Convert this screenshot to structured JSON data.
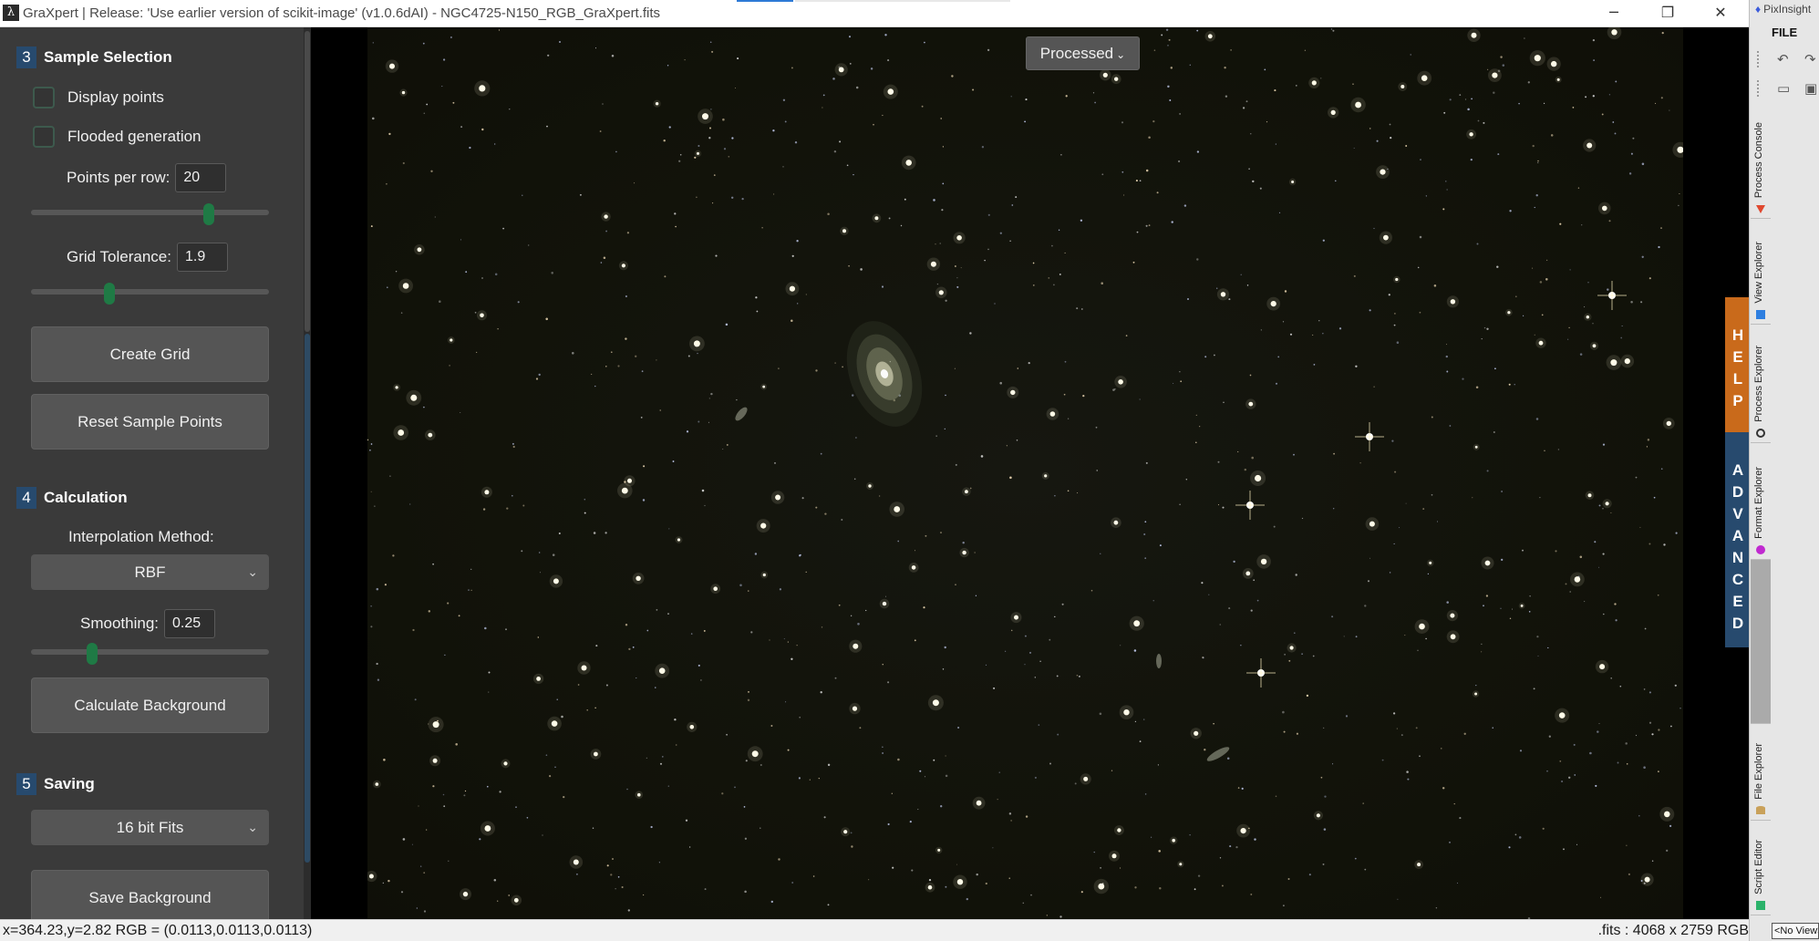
{
  "window": {
    "title": "GraXpert | Release: 'Use earlier version of scikit-image' (v1.0.6dAI) - NGC4725-N150_RGB_GraXpert.fits",
    "app_icon": "λ",
    "minimize": "─",
    "maximize": "❐",
    "close": "✕"
  },
  "sections": {
    "sample_selection": {
      "number": "3",
      "title": "Sample Selection",
      "display_points": "Display points",
      "flooded_generation": "Flooded generation",
      "points_per_row_label": "Points per row:",
      "points_per_row_value": "20",
      "points_per_row_slider": 0.76,
      "grid_tolerance_label": "Grid Tolerance:",
      "grid_tolerance_value": "1.9",
      "grid_tolerance_slider": 0.33,
      "create_grid": "Create Grid",
      "reset_sample_points": "Reset Sample Points"
    },
    "calculation": {
      "number": "4",
      "title": "Calculation",
      "interpolation_label": "Interpolation Method:",
      "interpolation_value": "RBF",
      "smoothing_label": "Smoothing:",
      "smoothing_value": "0.25",
      "smoothing_slider": 0.25,
      "calculate_background": "Calculate Background"
    },
    "saving": {
      "number": "5",
      "title": "Saving",
      "format_value": "16 bit Fits",
      "save_background": "Save Background"
    }
  },
  "canvas": {
    "view_selector": "Processed",
    "help_tab": [
      "H",
      "E",
      "L",
      "P"
    ],
    "advanced_tab": [
      "A",
      "D",
      "V",
      "A",
      "N",
      "C",
      "E",
      "D"
    ]
  },
  "statusbar": {
    "left": "x=364.23,y=2.82  RGB = (0.0113,0.0113,0.0113)",
    "right": ".fits : 4068 x 2759 RGB"
  },
  "pixinsight": {
    "logo": "PixInsight",
    "file_menu": "FILE",
    "tabs": [
      "Process Console",
      "View Explorer",
      "Process Explorer",
      "Format Explorer",
      "File Explorer",
      "Script Editor"
    ],
    "no_view": "<No View>"
  },
  "colors": {
    "panel_bg": "#3a3a3a",
    "section_badge": "#274a6e",
    "slider_knob": "#1f7a45",
    "button_bg": "#555555",
    "help_tab": "#c96a1b",
    "advanced_tab": "#274a6e"
  },
  "icons": {
    "chevron": "chevron-down-icon",
    "undo": "undo-icon",
    "redo": "redo-icon",
    "monitor": "monitor-icon"
  }
}
